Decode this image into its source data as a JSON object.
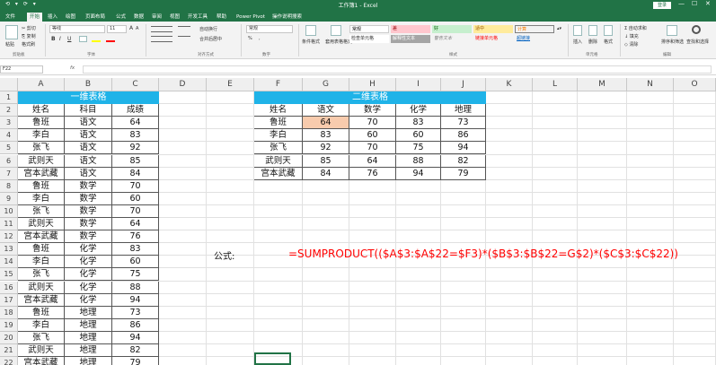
{
  "titlebar": {
    "title": "工作簿1 - Excel",
    "signin": "登录",
    "qat": "⟲ ▾ ⟳ ▾",
    "win_min": "—",
    "win_max": "☐",
    "win_close": "✕"
  },
  "tabs": [
    "文件",
    "开始",
    "插入",
    "绘图",
    "页面布局",
    "公式",
    "数据",
    "审阅",
    "视图",
    "开发工具",
    "帮助",
    "Power Pivot",
    "操作说明搜索"
  ],
  "ribbon": {
    "clipboard": {
      "paste": "粘贴",
      "cut": "✂ 剪切",
      "copy": "⎘ 复制",
      "format_painter": "格式刷",
      "label": "剪贴板"
    },
    "font": {
      "name": "等线",
      "size": "11",
      "bold": "B",
      "italic": "I",
      "underline": "U",
      "grow": "A",
      "shrink": "A",
      "label": "字体"
    },
    "alignment": {
      "wrap": "自动换行",
      "merge": "合并后居中",
      "label": "对齐方式"
    },
    "number": {
      "format": "常规",
      "percent": "%",
      "comma": ",",
      "label": "数字"
    },
    "styles": {
      "cond": "条件格式",
      "table": "套用表格格式",
      "s_normal": "常规",
      "s_bad": "差",
      "s_good": "好",
      "s_neutral": "适中",
      "s_calc": "计算",
      "s_check": "检查单元格",
      "s_explain": "解释性文本",
      "s_warning": "警告文本",
      "s_link": "链接单元格",
      "s_output": "超链接",
      "label": "样式"
    },
    "cells": {
      "insert": "插入",
      "delete": "删除",
      "format": "格式",
      "label": "单元格"
    },
    "editing": {
      "autosum": "Σ 自动求和",
      "fill": "↓ 填充",
      "clear": "◇ 清除",
      "sort": "排序和筛选",
      "find": "查找和选择",
      "label": "编辑"
    }
  },
  "formula_bar": {
    "name_box": "F22",
    "fx": "fx",
    "value": ""
  },
  "columns": [
    "A",
    "B",
    "C",
    "D",
    "E",
    "F",
    "G",
    "H",
    "I",
    "J",
    "K",
    "L",
    "M",
    "N",
    "O"
  ],
  "rows": [
    "1",
    "2",
    "3",
    "4",
    "5",
    "6",
    "7",
    "8",
    "9",
    "10",
    "11",
    "12",
    "13",
    "14",
    "15",
    "16",
    "17",
    "18",
    "19",
    "20",
    "21",
    "22"
  ],
  "table1": {
    "title": "一维表格",
    "headers": [
      "姓名",
      "科目",
      "成绩"
    ],
    "rows": [
      [
        "鲁班",
        "语文",
        "64"
      ],
      [
        "李白",
        "语文",
        "83"
      ],
      [
        "张飞",
        "语文",
        "92"
      ],
      [
        "武则天",
        "语文",
        "85"
      ],
      [
        "宫本武藏",
        "语文",
        "84"
      ],
      [
        "鲁班",
        "数学",
        "70"
      ],
      [
        "李白",
        "数学",
        "60"
      ],
      [
        "张飞",
        "数学",
        "70"
      ],
      [
        "武则天",
        "数学",
        "64"
      ],
      [
        "宫本武藏",
        "数学",
        "76"
      ],
      [
        "鲁班",
        "化学",
        "83"
      ],
      [
        "李白",
        "化学",
        "60"
      ],
      [
        "张飞",
        "化学",
        "75"
      ],
      [
        "武则天",
        "化学",
        "88"
      ],
      [
        "宫本武藏",
        "化学",
        "94"
      ],
      [
        "鲁班",
        "地理",
        "73"
      ],
      [
        "李白",
        "地理",
        "86"
      ],
      [
        "张飞",
        "地理",
        "94"
      ],
      [
        "武则天",
        "地理",
        "82"
      ],
      [
        "宫本武藏",
        "地理",
        "79"
      ]
    ]
  },
  "table2": {
    "title": "二维表格",
    "headers": [
      "姓名",
      "语文",
      "数学",
      "化学",
      "地理"
    ],
    "rows": [
      [
        "鲁班",
        "64",
        "70",
        "83",
        "73"
      ],
      [
        "李白",
        "83",
        "60",
        "60",
        "86"
      ],
      [
        "张飞",
        "92",
        "70",
        "75",
        "94"
      ],
      [
        "武则天",
        "85",
        "64",
        "88",
        "82"
      ],
      [
        "宫本武藏",
        "84",
        "76",
        "94",
        "79"
      ]
    ],
    "highlight_color": "#f8cbad"
  },
  "formula_label": "公式:",
  "formula_text": "=SUMPRODUCT(($A$3:$A$22=$F3)*($B$3:$B$22=G$2)*($C$3:$C$22))",
  "colors": {
    "excel_green": "#217346",
    "banner": "#1fb3e8",
    "formula": "#ff0000"
  }
}
